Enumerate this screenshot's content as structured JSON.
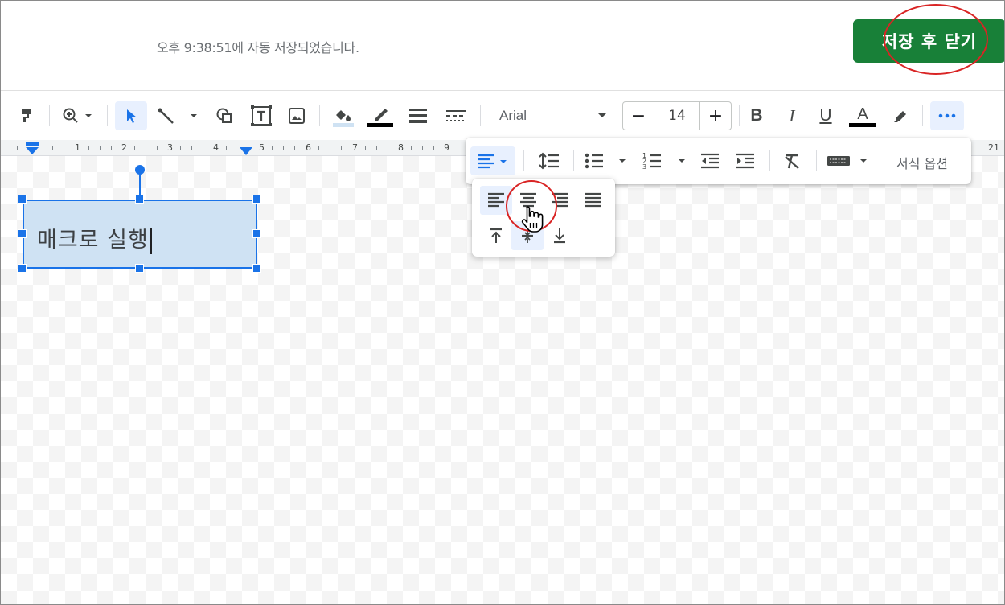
{
  "header": {
    "autosave_text": "오후 9:38:51에 자동 저장되었습니다.",
    "save_close_label": "저장 후 닫기"
  },
  "toolbar": {
    "font_name": "Arial",
    "font_size": "14",
    "size_minus": "−",
    "size_plus": "+",
    "bold": "B",
    "italic": "I",
    "underline": "U",
    "text_color_letter": "A",
    "icons": [
      "paint-format-icon",
      "zoom-icon",
      "select-icon",
      "line-icon",
      "shape-icon",
      "text-box-icon",
      "image-icon",
      "fill-color-icon",
      "border-color-icon",
      "border-weight-icon",
      "border-dash-icon",
      "highlight-icon",
      "more-icon"
    ]
  },
  "ruler": {
    "labels": [
      "1",
      "2",
      "3",
      "4",
      "5",
      "6",
      "7",
      "8",
      "9",
      "21"
    ]
  },
  "canvas": {
    "textbox_text": "매크로 실행"
  },
  "more_toolbar": {
    "format_options_label": "서식 옵션",
    "icons": [
      "align-left-icon",
      "line-spacing-icon",
      "bulleted-list-icon",
      "numbered-list-icon",
      "decrease-indent-icon",
      "increase-indent-icon",
      "clear-formatting-icon",
      "keyboard-icon"
    ]
  },
  "align_menu": {
    "horizontal": [
      "align-left",
      "align-center",
      "align-right",
      "align-justify"
    ],
    "vertical": [
      "align-top",
      "align-middle",
      "align-bottom"
    ],
    "selected_horizontal": "align-left",
    "selected_vertical": "align-middle"
  },
  "colors": {
    "accent": "#1a73e8",
    "save_button": "#188038",
    "annotation": "#d92424",
    "textbox_fill": "#cfe2f3"
  }
}
